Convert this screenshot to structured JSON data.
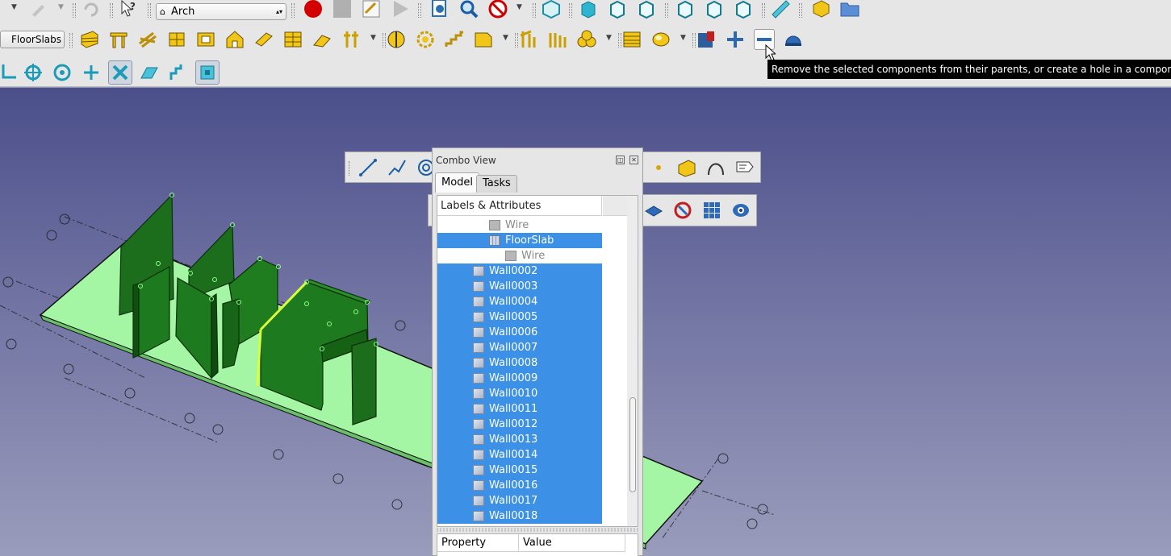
{
  "toolbar": {
    "workbench": "Arch",
    "floorslabs_label": "FloorSlabs"
  },
  "tooltip": "Remove the selected components from their parents, or create a hole in a component",
  "combo_view": {
    "title": "Combo View",
    "tabs": [
      "Model",
      "Tasks"
    ],
    "tree_header": "Labels & Attributes",
    "rows": [
      {
        "label": "Wire",
        "icon": "wire-icon",
        "indent": 1,
        "selected": false,
        "dimmed": true
      },
      {
        "label": "FloorSlab",
        "icon": "floorslab-icon",
        "indent": 1,
        "selected": true,
        "dimmed": false,
        "expanded": true
      },
      {
        "label": "Wire",
        "icon": "wire-icon",
        "indent": 2,
        "selected": false,
        "dimmed": true
      },
      {
        "label": "Wall0002",
        "icon": "wall-icon",
        "indent": 0,
        "selected": true
      },
      {
        "label": "Wall0003",
        "icon": "wall-icon",
        "indent": 0,
        "selected": true
      },
      {
        "label": "Wall0004",
        "icon": "wall-icon",
        "indent": 0,
        "selected": true
      },
      {
        "label": "Wall0005",
        "icon": "wall-icon",
        "indent": 0,
        "selected": true
      },
      {
        "label": "Wall0006",
        "icon": "wall-icon",
        "indent": 0,
        "selected": true
      },
      {
        "label": "Wall0007",
        "icon": "wall-icon",
        "indent": 0,
        "selected": true
      },
      {
        "label": "Wall0008",
        "icon": "wall-icon",
        "indent": 0,
        "selected": true
      },
      {
        "label": "Wall0009",
        "icon": "wall-icon",
        "indent": 0,
        "selected": true
      },
      {
        "label": "Wall0010",
        "icon": "wall-icon",
        "indent": 0,
        "selected": true
      },
      {
        "label": "Wall0011",
        "icon": "wall-icon",
        "indent": 0,
        "selected": true
      },
      {
        "label": "Wall0012",
        "icon": "wall-icon",
        "indent": 0,
        "selected": true
      },
      {
        "label": "Wall0013",
        "icon": "wall-icon",
        "indent": 0,
        "selected": true
      },
      {
        "label": "Wall0014",
        "icon": "wall-icon",
        "indent": 0,
        "selected": true
      },
      {
        "label": "Wall0015",
        "icon": "wall-icon",
        "indent": 0,
        "selected": true
      },
      {
        "label": "Wall0016",
        "icon": "wall-icon",
        "indent": 0,
        "selected": true
      },
      {
        "label": "Wall0017",
        "icon": "wall-icon",
        "indent": 0,
        "selected": true
      },
      {
        "label": "Wall0018",
        "icon": "wall-icon",
        "indent": 0,
        "selected": true
      }
    ],
    "property_columns": [
      "Property",
      "Value"
    ]
  },
  "colors": {
    "selection": "#3c91e6",
    "wall": "#1e7a1e",
    "slab": "#a4f5a4",
    "background_top": "#4b4f8a",
    "background_bottom": "#9a9cbc"
  }
}
